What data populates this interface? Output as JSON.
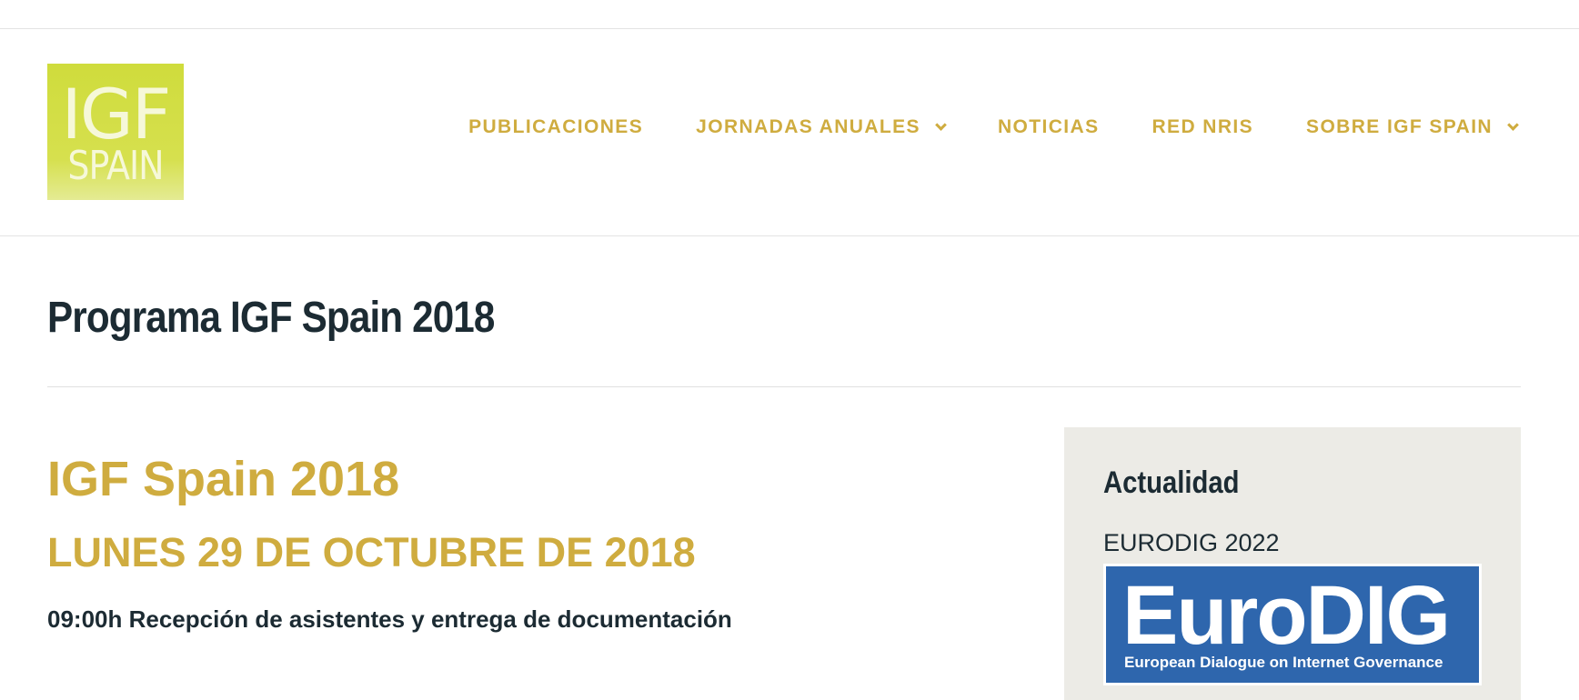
{
  "logo": {
    "line1": "IGF",
    "line2": "SPAIN",
    "color": "#d3de45"
  },
  "nav": {
    "items": [
      {
        "label": "PUBLICACIONES",
        "has_dropdown": false
      },
      {
        "label": "JORNADAS ANUALES",
        "has_dropdown": true
      },
      {
        "label": "NOTICIAS",
        "has_dropdown": false
      },
      {
        "label": "RED NRIS",
        "has_dropdown": false
      },
      {
        "label": "SOBRE IGF SPAIN",
        "has_dropdown": true
      }
    ],
    "color": "#cfac3f"
  },
  "page": {
    "title": "Programa IGF Spain 2018"
  },
  "content": {
    "event_title": "IGF Spain 2018",
    "event_date": "LUNES 29 DE OCTUBRE DE 2018",
    "agenda": [
      "09:00h Recepción de asistentes y entrega de documentación"
    ],
    "accent_color": "#cfac3f"
  },
  "sidebar": {
    "heading": "Actualidad",
    "item_title": "EURODIG 2022",
    "banner": {
      "wordmark": "EuroDIG",
      "tagline": "European Dialogue on Internet Governance",
      "color": "#2e66ad"
    },
    "background": "#ecebe6"
  }
}
